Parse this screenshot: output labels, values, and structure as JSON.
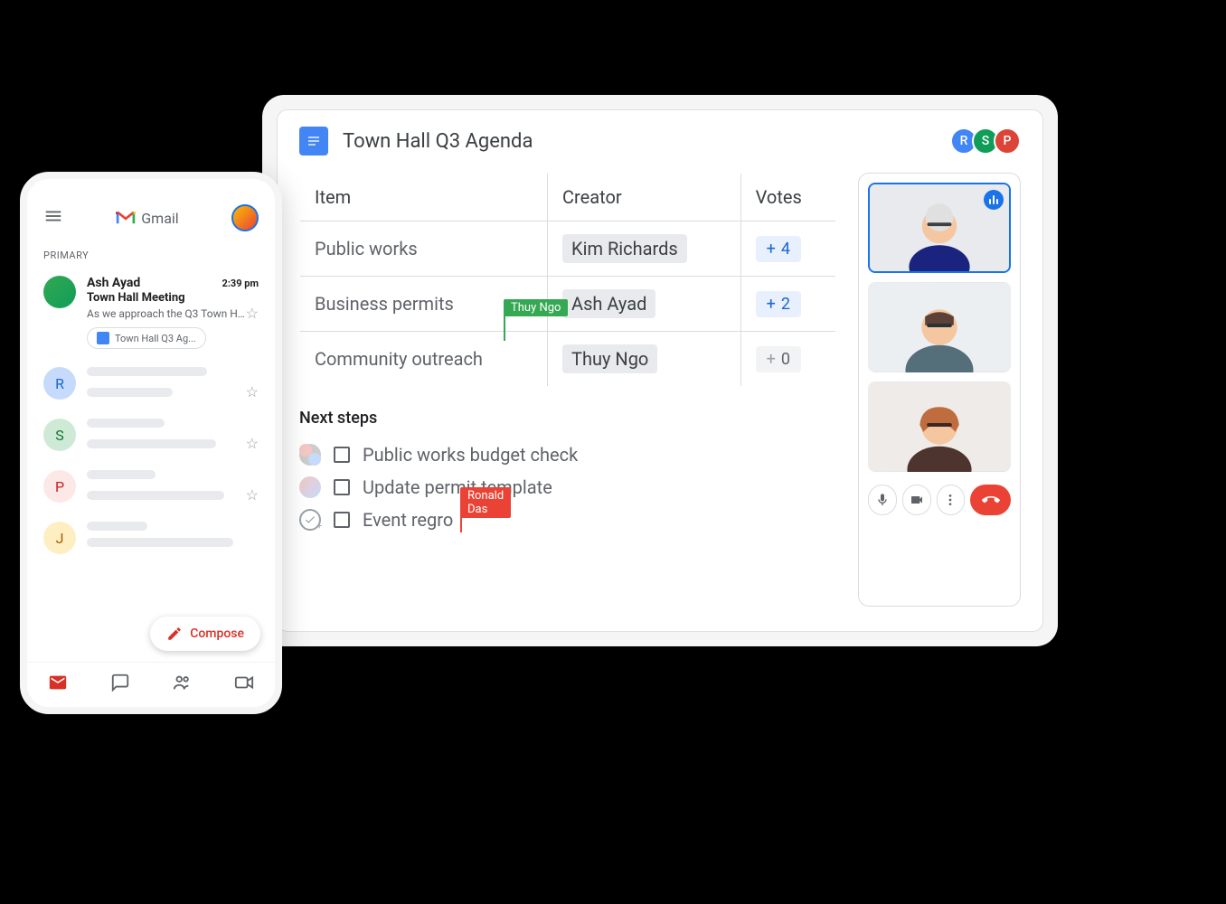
{
  "docs": {
    "title": "Town Hall Q3 Agenda",
    "collaborators": [
      {
        "initial": "R",
        "color": "blue"
      },
      {
        "initial": "S",
        "color": "green"
      },
      {
        "initial": "P",
        "color": "red"
      }
    ],
    "table": {
      "headers": {
        "item": "Item",
        "creator": "Creator",
        "votes": "Votes"
      },
      "rows": [
        {
          "item": "Public works",
          "creator": "Kim Richards",
          "votes": "4",
          "votes_zero": false
        },
        {
          "item": "Business permits",
          "creator": "Ash Ayad",
          "votes": "2",
          "votes_zero": false
        },
        {
          "item": "Community outreach",
          "creator": "Thuy Ngo",
          "votes": "0",
          "votes_zero": true
        }
      ]
    },
    "cursors": {
      "thuy": "Thuy Ngo",
      "ronald": "Ronald Das"
    },
    "next_steps": {
      "title": "Next steps",
      "items": [
        {
          "text": "Public works budget check"
        },
        {
          "text": "Update permit template"
        },
        {
          "text": "Event regro"
        }
      ]
    }
  },
  "meet": {
    "participants": 3
  },
  "gmail": {
    "app_name": "Gmail",
    "tab_label": "PRIMARY",
    "compose_label": "Compose",
    "featured_email": {
      "sender": "Ash Ayad",
      "time": "2:39 pm",
      "subject": "Town Hall Meeting",
      "preview": "As we approach the Q3 Town Ha...",
      "attachment": "Town Hall Q3 Ag..."
    },
    "skeleton_avatars": [
      "R",
      "S",
      "P",
      "J"
    ]
  }
}
